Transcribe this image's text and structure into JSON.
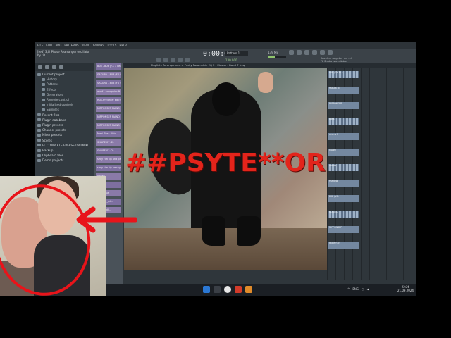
{
  "menu": [
    "FILE",
    "EDIT",
    "ADD",
    "PATTERNS",
    "VIEW",
    "OPTIONS",
    "TOOLS",
    "HELP"
  ],
  "toolbar": {
    "hint_line1": "[red] 3,0l Phase Rearranger oscillator",
    "hint_line2": "by 04",
    "time": "0:00:00",
    "pattern": "Pattern 1",
    "bpm": "130.000",
    "cpu": "139 MB",
    "news_line1": "Aus dem ratgeber um ref",
    "news_line2": "FL Studio is available"
  },
  "browser": {
    "items": [
      {
        "label": "Current project",
        "sub": false
      },
      {
        "label": "History",
        "sub": true
      },
      {
        "label": "Patterns",
        "sub": true
      },
      {
        "label": "Effects",
        "sub": true
      },
      {
        "label": "Generators",
        "sub": true
      },
      {
        "label": "Remote control",
        "sub": true
      },
      {
        "label": "Initialized controls",
        "sub": true
      },
      {
        "label": "Samples",
        "sub": true
      },
      {
        "label": "Recent files",
        "sub": false
      },
      {
        "label": "Plugin database",
        "sub": false
      },
      {
        "label": "Plugin presets",
        "sub": false
      },
      {
        "label": "Channel presets",
        "sub": false
      },
      {
        "label": "Mixer presets",
        "sub": false
      },
      {
        "label": "Scores",
        "sub": false
      },
      {
        "label": "FL COMPLETE FREESE DRUM KIT",
        "sub": false
      },
      {
        "label": "Backup",
        "sub": false
      },
      {
        "label": "Clipboard files",
        "sub": false
      },
      {
        "label": "Demo projects",
        "sub": false
      }
    ]
  },
  "channels": [
    "808 - 808 (FX 3 Lea)",
    "SAKURA - 808 (FX Sta)",
    "SAKURA - 808 (FX Sta)",
    "atmf - noxcpyim.ft",
    "Run-mydm ef ed (flex)",
    "NIPPONSEP PIANO + FL",
    "NIPPONSEP PIANO + FL",
    "NIPPONSEP PIANO + FL",
    "Maxi Bass Plstx",
    "SNARE 07 (2)",
    "SNARE 03 (2)",
    "sexy rim tip and phl",
    "sexy rim tip nehagan",
    "vocals",
    "vocals",
    "melon_us",
    "shadow_rd...",
    "melon_dl..."
  ],
  "playlist": {
    "title": "Playlist - Arrangement > Fruity Parametric EQ 2 - Master - Band 7 freq",
    "clips": [
      "808 (FX 3 L)",
      "sakura (x)",
      "NIPPONSEP",
      "Bass",
      "drums 2",
      "PIANO",
      "vocals",
      "shadow",
      "808 (x3)",
      "FLXOTC",
      "NIPPONSEP",
      "Pattern 9"
    ]
  },
  "artwork": {
    "title": "##PSYTE**OR"
  },
  "taskbar": {
    "tray_lang": "ENG",
    "clock_time": "22:26",
    "clock_date": "21.09.2024"
  },
  "colors": {
    "title_red": "#e3241b",
    "circle_red": "#e8141a",
    "channel_purple": "#8a7aa8"
  }
}
